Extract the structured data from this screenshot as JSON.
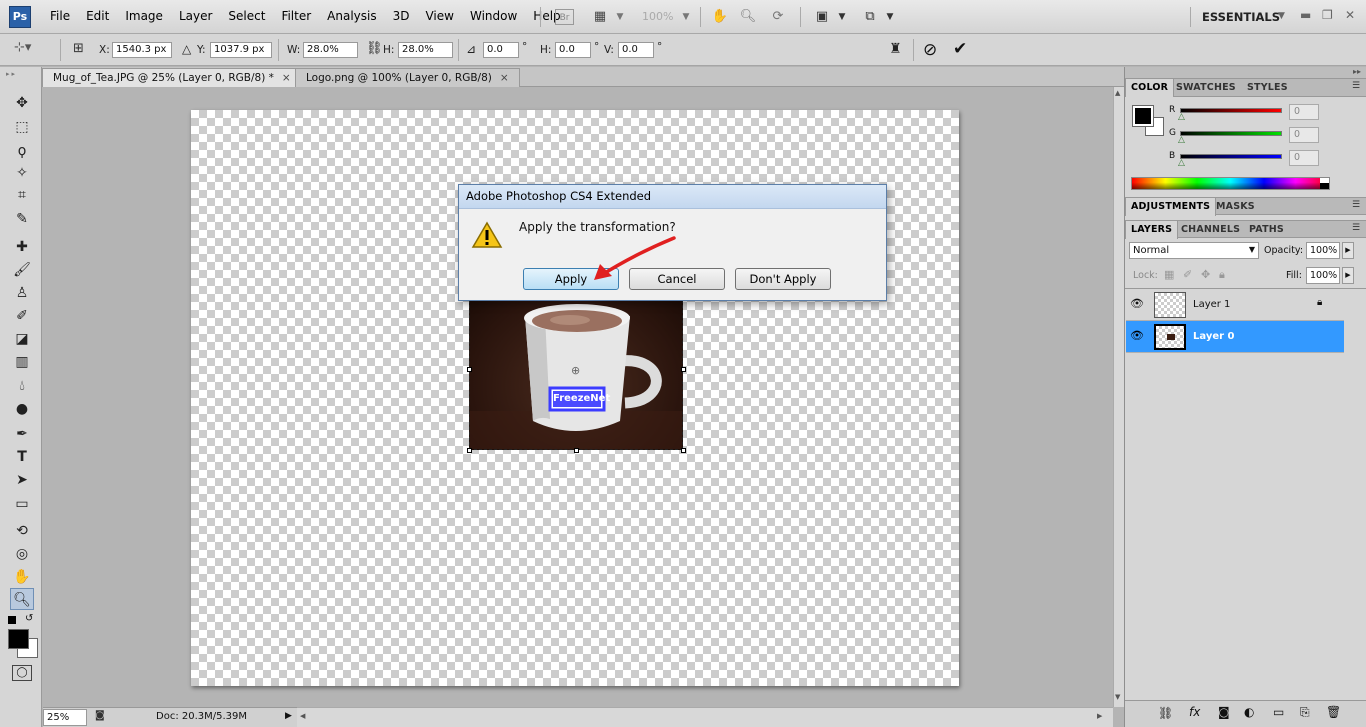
{
  "app": {
    "logo": "Ps",
    "menu": [
      "File",
      "Edit",
      "Image",
      "Layer",
      "Select",
      "Filter",
      "Analysis",
      "3D",
      "View",
      "Window",
      "Help"
    ],
    "bridge_label": "Br",
    "zoom_display": "100%",
    "workspace": "ESSENTIALS"
  },
  "options": {
    "x_label": "X:",
    "x_value": "1540.3 px",
    "y_label": "Y:",
    "y_value": "1037.9 px",
    "w_label": "W:",
    "w_value": "28.0%",
    "h_label": "H:",
    "h_value": "28.0%",
    "angle_value": "0.0",
    "angle_unit": "°",
    "hskew_label": "H:",
    "hskew_value": "0.0",
    "hskew_unit": "°",
    "vskew_label": "V:",
    "vskew_value": "0.0",
    "vskew_unit": "°"
  },
  "tabs": [
    {
      "label": "Mug_of_Tea.JPG @ 25% (Layer 0, RGB/8) *",
      "close": "×"
    },
    {
      "label": "Logo.png @ 100% (Layer 0, RGB/8)",
      "close": "×"
    }
  ],
  "canvas": {
    "watermark_text": "FreezeNet"
  },
  "dialog": {
    "title": "Adobe Photoshop CS4 Extended",
    "message": "Apply the transformation?",
    "apply": "Apply",
    "cancel": "Cancel",
    "dont_apply": "Don't Apply"
  },
  "status": {
    "zoom": "25%",
    "doc": "Doc: 20.3M/5.39M"
  },
  "color_panel": {
    "tabs": [
      "COLOR",
      "SWATCHES",
      "STYLES"
    ],
    "r_label": "R",
    "r_value": "0",
    "g_label": "G",
    "g_value": "0",
    "b_label": "B",
    "b_value": "0"
  },
  "adjust_panel": {
    "tabs": [
      "ADJUSTMENTS",
      "MASKS"
    ]
  },
  "layers_panel": {
    "tabs": [
      "LAYERS",
      "CHANNELS",
      "PATHS"
    ],
    "blend_mode": "Normal",
    "opacity_label": "Opacity:",
    "opacity_value": "100%",
    "lock_label": "Lock:",
    "fill_label": "Fill:",
    "fill_value": "100%",
    "layers": [
      {
        "name": "Layer 1",
        "selected": false
      },
      {
        "name": "Layer 0",
        "selected": true
      }
    ]
  },
  "colors": {
    "selection_blue": "#3399ff",
    "dialog_title_bg": "#c3d7ef",
    "arrow_red": "#e02020"
  }
}
